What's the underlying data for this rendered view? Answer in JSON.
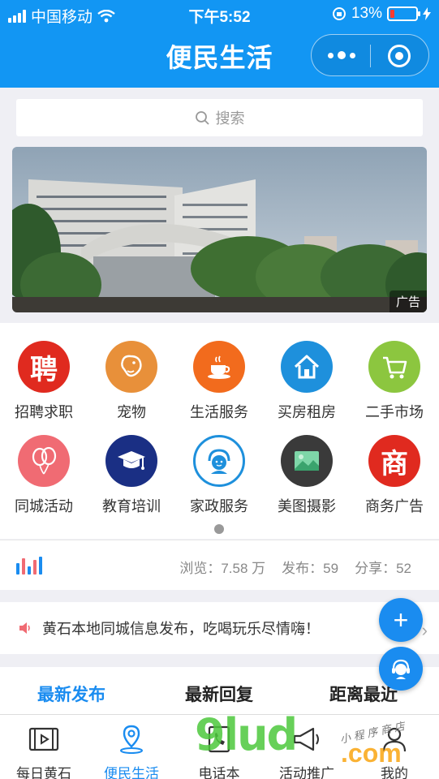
{
  "status_bar": {
    "carrier": "中国移动",
    "time": "下午5:52",
    "battery": "13%"
  },
  "nav": {
    "title": "便民生活"
  },
  "search": {
    "placeholder": "搜索"
  },
  "banner": {
    "ad_label": "广告"
  },
  "categories": [
    {
      "label": "招聘求职",
      "icon": "pin-recruit-icon",
      "glyph": "聘",
      "color": "#e02a1f"
    },
    {
      "label": "宠物",
      "icon": "dog-icon",
      "color": "#e8903a"
    },
    {
      "label": "生活服务",
      "icon": "coffee-icon",
      "color": "#f26b1d"
    },
    {
      "label": "买房租房",
      "icon": "house-icon",
      "color": "#1e90dc"
    },
    {
      "label": "二手市场",
      "icon": "cart-icon",
      "color": "#8cc63f"
    },
    {
      "label": "同城活动",
      "icon": "balloon-icon",
      "color": "#f06b73"
    },
    {
      "label": "教育培训",
      "icon": "grad-cap-icon",
      "color": "#1a2f84"
    },
    {
      "label": "家政服务",
      "icon": "housekeeper-icon",
      "color": "#1e90dc"
    },
    {
      "label": "美图摄影",
      "icon": "photo-icon",
      "color": "#3a3a3a"
    },
    {
      "label": "商务广告",
      "icon": "business-icon",
      "glyph": "商",
      "color": "#e02a1f"
    }
  ],
  "stats": {
    "views": "浏览：7.58 万",
    "posts": "发布：59",
    "shares": "分享：52"
  },
  "notice": {
    "text": "黄石本地同城信息发布，吃喝玩乐尽情嗨！"
  },
  "tabs": [
    {
      "label": "最新发布",
      "active": true
    },
    {
      "label": "最新回复",
      "active": false
    },
    {
      "label": "距离最近",
      "active": false
    }
  ],
  "fab": {
    "add": "+"
  },
  "tabbar": [
    {
      "label": "每日黄石",
      "icon": "video-icon",
      "active": false
    },
    {
      "label": "便民生活",
      "icon": "location-pin-icon",
      "active": true
    },
    {
      "label": "电话本",
      "icon": "phone-book-icon",
      "active": false
    },
    {
      "label": "活动推广",
      "icon": "megaphone-icon",
      "active": false
    },
    {
      "label": "我的",
      "icon": "user-icon",
      "active": false
    }
  ],
  "watermark": {
    "main": "9lud",
    "suffix": ".com",
    "tagline": "小程序商店"
  }
}
